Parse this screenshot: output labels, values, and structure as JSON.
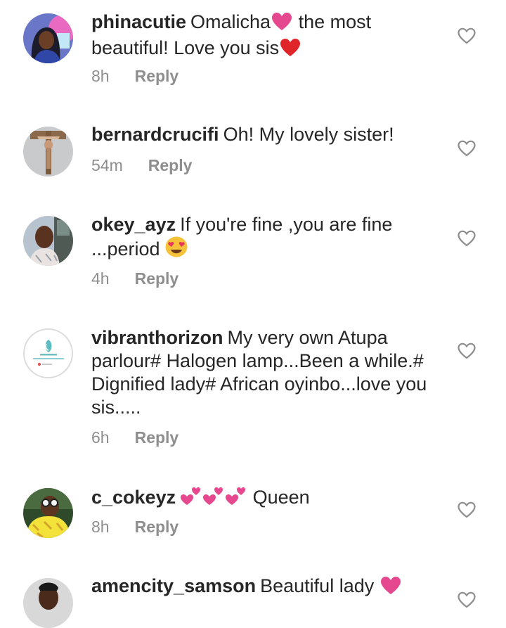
{
  "comments": [
    {
      "username": "phinacutie",
      "text_part1": "Omalicha",
      "text_part2": " the most beautiful!  Love you sis",
      "time": "8h",
      "reply_label": "Reply"
    },
    {
      "username": "bernardcrucifi",
      "text": "Oh! My lovely sister!",
      "time": "54m",
      "reply_label": "Reply"
    },
    {
      "username": "okey_ayz",
      "text": "If you're fine ,you are fine ...period",
      "time": "4h",
      "reply_label": "Reply"
    },
    {
      "username": "vibranthorizon",
      "text": "My very own Atupa parlour# Halogen lamp...Been a while.# Dignified lady# African oyinbo...love you sis.....",
      "time": "6h",
      "reply_label": "Reply"
    },
    {
      "username": "c_cokeyz",
      "text": "Queen",
      "time": "8h",
      "reply_label": "Reply"
    },
    {
      "username": "amencity_samson",
      "text": "Beautiful lady"
    }
  ],
  "icons": {
    "like": "heart-outline-icon",
    "red_heart": "red-heart-emoji",
    "pink_heart": "pink-heart-emoji",
    "two_hearts": "two-hearts-emoji",
    "heart_eyes": "smiling-face-with-heart-eyes-emoji"
  },
  "colors": {
    "text": "#262626",
    "secondary": "#8e8e8e",
    "heart_red": "#e0252a",
    "heart_pink": "#e5488e"
  }
}
